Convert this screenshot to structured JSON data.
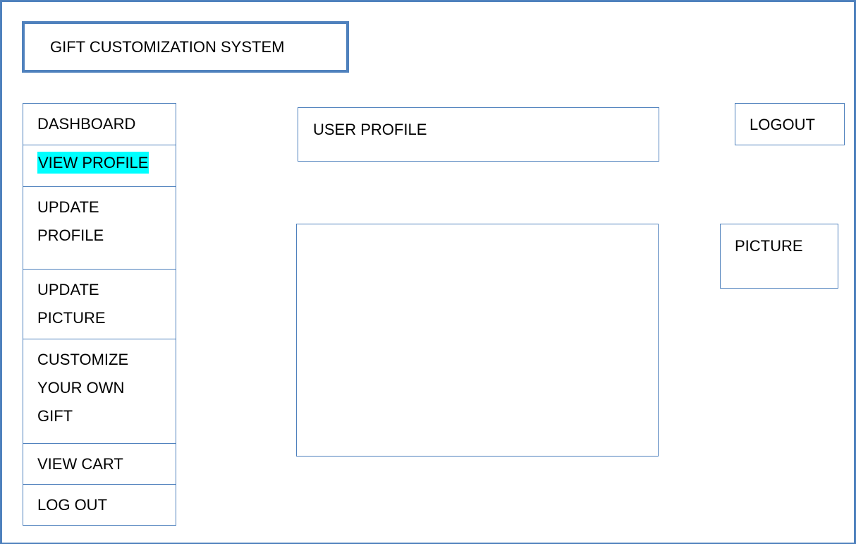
{
  "app": {
    "title": "GIFT CUSTOMIZATION SYSTEM"
  },
  "sidebar": {
    "items": [
      {
        "label": "DASHBOARD"
      },
      {
        "label": "VIEW PROFILE",
        "highlighted": true,
        "highlight_color": "#00ffff"
      },
      {
        "label": "UPDATE\nPROFILE"
      },
      {
        "label": "UPDATE\nPICTURE"
      },
      {
        "label": "CUSTOMIZE\nYOUR OWN\nGIFT"
      },
      {
        "label": "VIEW CART"
      },
      {
        "label": "LOG OUT"
      }
    ]
  },
  "main": {
    "header_label": "USER PROFILE",
    "logout_label": "LOGOUT",
    "picture_label": "PICTURE"
  },
  "colors": {
    "border": "#4f81bd",
    "highlight": "#00ffff",
    "background": "#ffffff",
    "text": "#000000"
  }
}
